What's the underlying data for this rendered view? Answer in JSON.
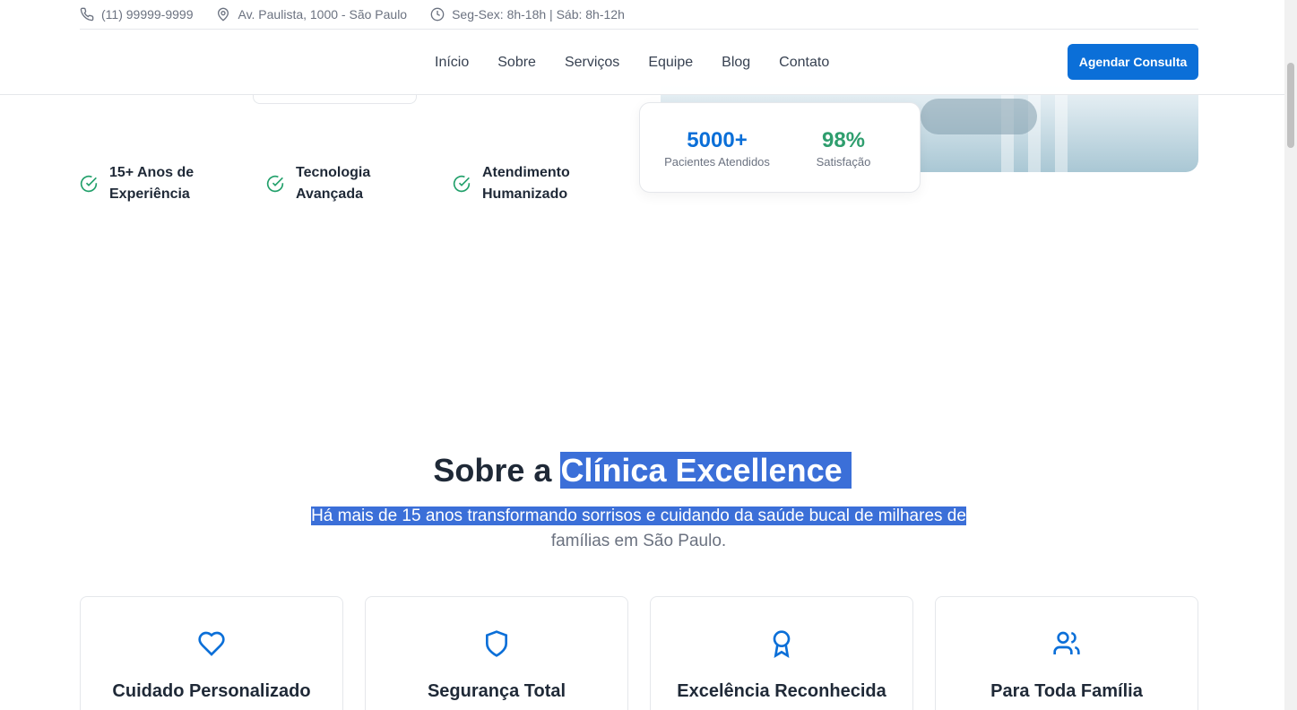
{
  "topbar": {
    "phone": "(11) 99999-9999",
    "address": "Av. Paulista, 1000 - São Paulo",
    "hours": "Seg-Sex: 8h-18h | Sáb: 8h-12h"
  },
  "nav": {
    "items": [
      "Início",
      "Sobre",
      "Serviços",
      "Equipe",
      "Blog",
      "Contato"
    ],
    "cta": "Agendar Consulta"
  },
  "features": [
    {
      "label": "15+ Anos de Experiência"
    },
    {
      "label": "Tecnologia Avançada"
    },
    {
      "label": "Atendimento Humanizado"
    }
  ],
  "stats": [
    {
      "value": "5000+",
      "label": "Pacientes Atendidos"
    },
    {
      "value": "98%",
      "label": "Satisfação"
    }
  ],
  "about": {
    "title_prefix": "Sobre a",
    "title_highlight": "Clínica Excellence",
    "subtitle_highlight": "Há mais de 15 anos transformando sorrisos e cuidando da saúde bucal de milhares de",
    "subtitle_rest": "famílias em São Paulo."
  },
  "cards": [
    {
      "title": "Cuidado Personalizado",
      "icon": "heart-icon"
    },
    {
      "title": "Segurança Total",
      "icon": "shield-icon"
    },
    {
      "title": "Excelência Reconhecida",
      "icon": "award-icon"
    },
    {
      "title": "Para Toda Família",
      "icon": "users-icon"
    }
  ],
  "colors": {
    "primary": "#0b6fd8",
    "success": "#2f9e6e",
    "selection": "#3b6fd8"
  }
}
